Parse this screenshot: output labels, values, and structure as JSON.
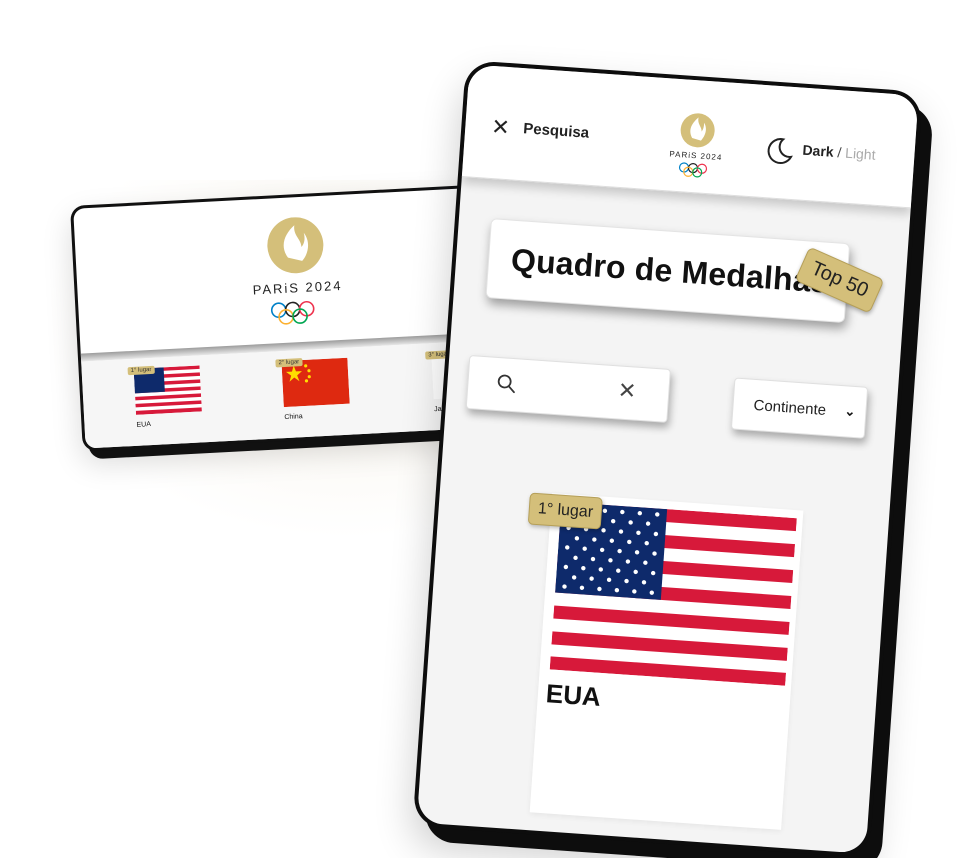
{
  "small_phone": {
    "logo_text": "PARiS 2024",
    "flags": [
      {
        "place": "1° lugar",
        "country": "EUA",
        "flag": "usa"
      },
      {
        "place": "2° lugar",
        "country": "China",
        "flag": "china"
      },
      {
        "place": "3° lugar",
        "country": "Ja",
        "flag": "japan"
      }
    ]
  },
  "big_phone": {
    "header": {
      "close_icon": "close-icon",
      "search_label": "Pesquisa",
      "logo_text": "PARiS 2024",
      "theme_dark": "Dark",
      "theme_separator": "/",
      "theme_light": "Light"
    },
    "title": "Quadro de Medalhas",
    "badge": "Top 50",
    "search": {
      "placeholder": ""
    },
    "continent_select": {
      "selected": "Continente"
    },
    "first_card": {
      "place": "1° lugar",
      "country": "EUA"
    }
  },
  "colors": {
    "gold": "#d4bf7a",
    "flag_red": "#d7193a",
    "flag_blue": "#0e2a6b"
  }
}
